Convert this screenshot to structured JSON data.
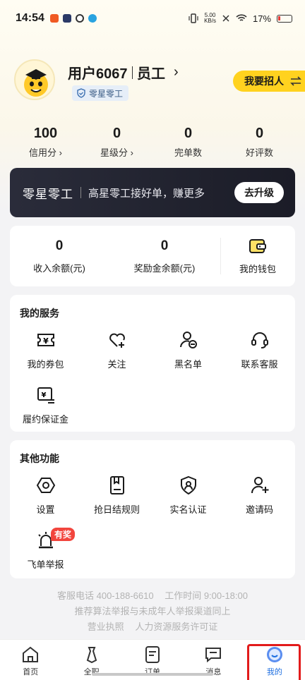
{
  "status_bar": {
    "time": "14:54",
    "net_speed_top": "5.00",
    "net_speed_bottom": "KB/s",
    "battery": "17%"
  },
  "profile": {
    "name": "用户6067",
    "role": "员工",
    "badge": "零星零工",
    "recruit_button": "我要招人"
  },
  "stats": [
    {
      "value": "100",
      "label": "信用分 ›"
    },
    {
      "value": "0",
      "label": "星级分 ›"
    },
    {
      "value": "0",
      "label": "完单数"
    },
    {
      "value": "0",
      "label": "好评数"
    }
  ],
  "banner": {
    "title": "零星零工",
    "subtitle": "高星零工接好单，赚更多",
    "button": "去升级"
  },
  "wallet": {
    "income_value": "0",
    "income_label": "收入余额(元)",
    "reward_value": "0",
    "reward_label": "奖励金余额(元)",
    "wallet_label": "我的钱包"
  },
  "services": {
    "title": "我的服务",
    "items": [
      {
        "label": "我的券包",
        "icon": "coupon-icon"
      },
      {
        "label": "关注",
        "icon": "heart-plus-icon"
      },
      {
        "label": "黑名单",
        "icon": "user-block-icon"
      },
      {
        "label": "联系客服",
        "icon": "headset-icon"
      },
      {
        "label": "履约保证金",
        "icon": "deposit-icon"
      }
    ]
  },
  "functions": {
    "title": "其他功能",
    "items": [
      {
        "label": "设置",
        "icon": "settings-icon"
      },
      {
        "label": "抢日结规则",
        "icon": "rules-book-icon"
      },
      {
        "label": "实名认证",
        "icon": "verify-shield-icon"
      },
      {
        "label": "邀请码",
        "icon": "invite-user-icon"
      },
      {
        "label": "飞单举报",
        "icon": "alarm-icon",
        "tag": "有奖"
      }
    ]
  },
  "footer": {
    "hotline": "客服电话 400-188-6610",
    "hours": "工作时间 9:00-18:00",
    "line2": "推荐算法举报与未成年人举报渠道同上",
    "license1": "营业执照",
    "license2": "人力资源服务许可证"
  },
  "tabbar": [
    {
      "label": "首页",
      "icon": "home-icon"
    },
    {
      "label": "全职",
      "icon": "tie-icon"
    },
    {
      "label": "订单",
      "icon": "order-icon"
    },
    {
      "label": "消息",
      "icon": "message-icon"
    },
    {
      "label": "我的",
      "icon": "profile-smile-icon",
      "active": true
    }
  ],
  "colors": {
    "accent_yellow": "#ffd21f",
    "active_tab": "#1f6fe0",
    "banner_bg": "#1b1c27",
    "tag_red": "#f2453d"
  }
}
